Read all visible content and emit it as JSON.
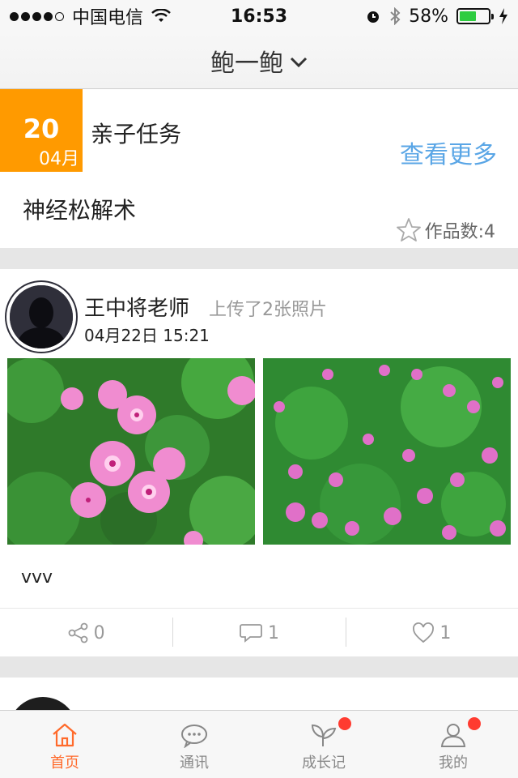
{
  "status_bar": {
    "carrier": "中国电信",
    "time": "16:53",
    "battery_percent": "58%",
    "battery_level": 0.58
  },
  "nav": {
    "title": "鲍一鲍"
  },
  "task": {
    "day": "20",
    "month": "04月",
    "type": "亲子任务",
    "see_more": "查看更多",
    "title": "神经松解术",
    "works_count": "作品数:4"
  },
  "post": {
    "author": "王中将老师",
    "action": "上传了2张照片",
    "time": "04月22日 15:21",
    "caption": "vvv",
    "share_count": "0",
    "comment_count": "1",
    "like_count": "1"
  },
  "tabs": [
    {
      "label": "首页",
      "icon": "home-icon",
      "active": true
    },
    {
      "label": "通讯",
      "icon": "chat-icon",
      "active": false
    },
    {
      "label": "成长记",
      "icon": "sprout-icon",
      "active": false
    },
    {
      "label": "我的",
      "icon": "user-icon",
      "active": false
    }
  ],
  "colors": {
    "accent": "#ff9a00",
    "link": "#5aa6e6",
    "tab_active": "#ff6a2b",
    "badge": "#ff3b30"
  }
}
